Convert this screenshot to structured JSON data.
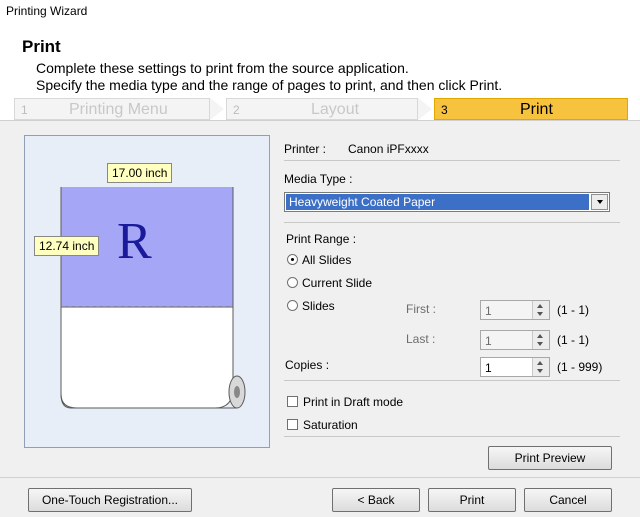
{
  "window": {
    "title": "Printing Wizard"
  },
  "header": {
    "title": "Print",
    "line1": "Complete these settings to print from the source application.",
    "line2": "Specify the media type and the range of pages to print, and then click Print."
  },
  "steps": [
    {
      "num": "1",
      "label": "Printing Menu"
    },
    {
      "num": "2",
      "label": "Layout"
    },
    {
      "num": "3",
      "label": "Print"
    }
  ],
  "preview": {
    "width_label": "17.00 inch",
    "height_label": "12.74 inch",
    "glyph": "R"
  },
  "printer": {
    "label": "Printer :",
    "value": "Canon iPFxxxx"
  },
  "media": {
    "label": "Media Type :",
    "value": "Heavyweight Coated Paper"
  },
  "range": {
    "label": "Print Range :",
    "options": [
      "All Slides",
      "Current Slide",
      "Slides"
    ],
    "first_label": "First :",
    "first_value": "1",
    "first_range": "(1 - 1)",
    "last_label": "Last :",
    "last_value": "1",
    "last_range": "(1 - 1)"
  },
  "copies": {
    "label": "Copies :",
    "value": "1",
    "range": "(1 - 999)"
  },
  "checks": {
    "draft": "Print in Draft mode",
    "saturation": "Saturation"
  },
  "buttons": {
    "preview": "Print Preview",
    "registration": "One-Touch Registration...",
    "back": "< Back",
    "print": "Print",
    "cancel": "Cancel"
  },
  "colors": {
    "accent": "#f7c23e",
    "selection": "#3c70c6",
    "paper": "#a6a6f7"
  }
}
